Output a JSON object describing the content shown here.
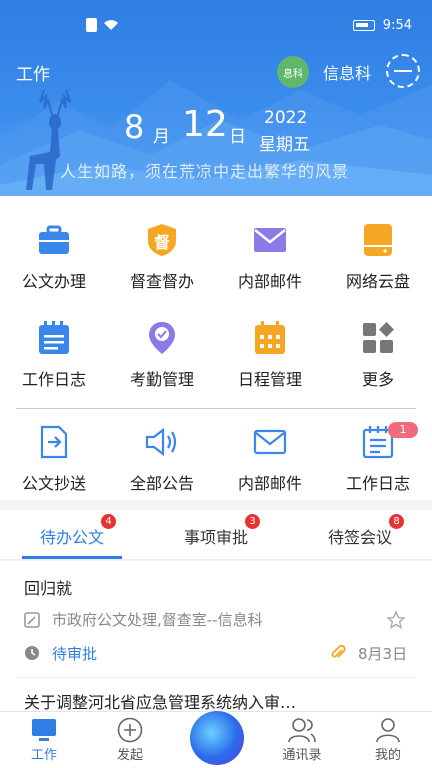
{
  "status_bar": {
    "time": "9:54"
  },
  "header": {
    "title": "工作",
    "dept_badge": "息科",
    "dept_name": "信息科",
    "date": {
      "month": "8",
      "month_unit": "月",
      "day": "12",
      "day_unit": "日",
      "year": "2022",
      "weekday": "星期五"
    },
    "motto": "人生如路，须在荒凉中走出繁华的风景"
  },
  "grid": {
    "row1": [
      {
        "label": "公文办理",
        "icon": "briefcase-icon"
      },
      {
        "label": "督查督办",
        "icon": "supervise-icon",
        "icon_text": "督"
      },
      {
        "label": "内部邮件",
        "icon": "mail-icon"
      },
      {
        "label": "网络云盘",
        "icon": "cloud-drive-icon"
      }
    ],
    "row2": [
      {
        "label": "工作日志",
        "icon": "calendar-log-icon"
      },
      {
        "label": "考勤管理",
        "icon": "location-check-icon"
      },
      {
        "label": "日程管理",
        "icon": "schedule-icon"
      },
      {
        "label": "更多",
        "icon": "more-grid-icon"
      }
    ],
    "row3": [
      {
        "label": "公文抄送",
        "icon": "forward-doc-icon"
      },
      {
        "label": "全部公告",
        "icon": "speaker-icon"
      },
      {
        "label": "内部邮件",
        "icon": "mail-outline-icon"
      },
      {
        "label": "工作日志",
        "icon": "notepad-icon",
        "badge": "1"
      }
    ]
  },
  "tabs": [
    {
      "label": "待办公文",
      "badge": "4",
      "active": true
    },
    {
      "label": "事项审批",
      "badge": "3"
    },
    {
      "label": "待签会议",
      "badge": "8"
    }
  ],
  "list": [
    {
      "title": "回归就",
      "subtitle": "市政府公文处理,督查室--信息科",
      "status": "待审批",
      "date": "8月3日"
    },
    {
      "title": "关于调整河北省应急管理系统纳入审…"
    }
  ],
  "bottom_nav": [
    {
      "label": "工作",
      "active": true
    },
    {
      "label": "发起"
    },
    {
      "label": "通讯录"
    },
    {
      "label": "我的"
    }
  ],
  "colors": {
    "accent": "#2f7ee3",
    "badge": "#e63333"
  }
}
